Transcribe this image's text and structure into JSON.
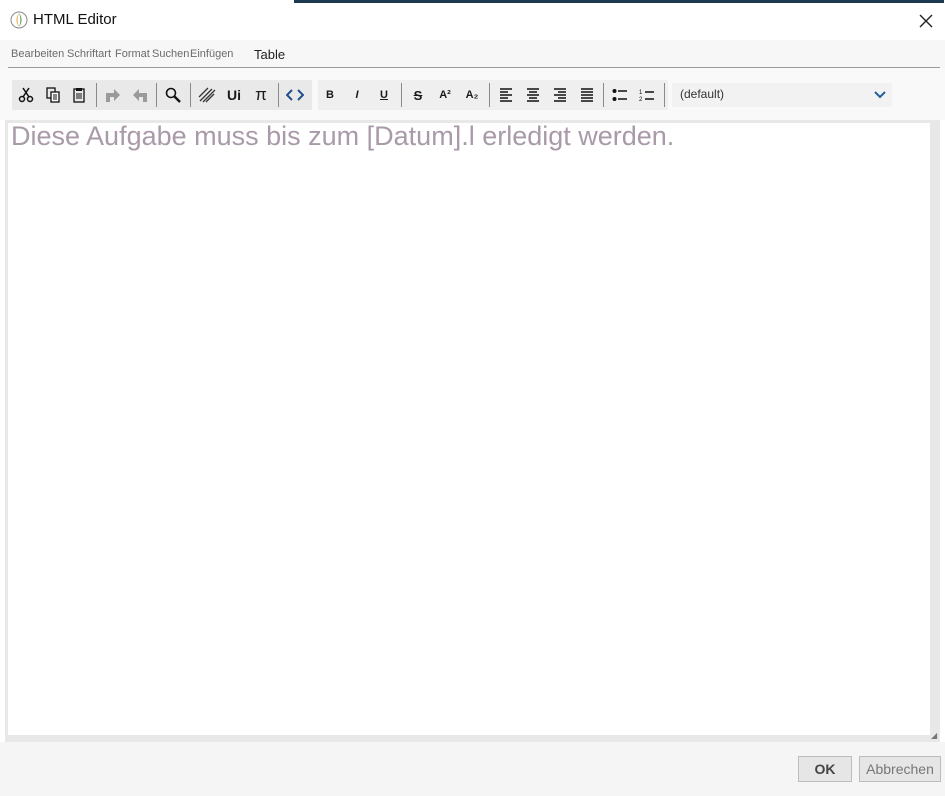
{
  "window": {
    "title": "HTML Editor"
  },
  "menu": {
    "items": [
      "Bearbeiten",
      "Schriftart",
      "Format",
      "Suchen",
      "Einfügen"
    ],
    "table": "Table"
  },
  "toolbar": {
    "font_select": {
      "value": "(default)"
    },
    "icons": [
      "cut-icon",
      "copy-icon",
      "paste-icon",
      "undo-icon",
      "redo-icon",
      "find-icon",
      "link-icon",
      "unicode-icon",
      "math-pi-icon",
      "source-code-icon",
      "bold-icon",
      "italic-icon",
      "underline-icon",
      "strikethrough-icon",
      "superscript-icon",
      "subscript-icon",
      "align-left-icon",
      "align-center-icon",
      "align-right-icon",
      "justify-icon",
      "bulleted-list-icon",
      "numbered-list-icon"
    ]
  },
  "editor": {
    "text": "Diese Aufgabe muss bis zum [Datum].l erledigt werden."
  },
  "buttons": {
    "ok": "OK",
    "cancel": "Abbrechen"
  },
  "colors": {
    "content_text": "#a99aa9",
    "dropdown_arrow": "#1f5fa0"
  }
}
